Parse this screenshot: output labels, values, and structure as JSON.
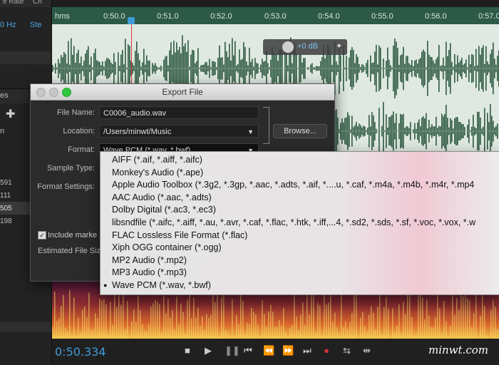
{
  "left_panel": {
    "header_fragments": [
      "e Rate",
      "Ch"
    ],
    "row_1": {
      "left": "0 Hz",
      "right": "Ste"
    },
    "tab_fragment": "es",
    "row_letter": "n",
    "numbers": [
      "591",
      "111",
      "505",
      "198"
    ]
  },
  "timeline": {
    "ruler_label": "hms",
    "ticks": [
      "0:50.0",
      "0:51.0",
      "0:52.0",
      "0:53.0",
      "0:54.0",
      "0:55.0",
      "0:56.0",
      "0:57.0"
    ],
    "hud_db": "+0 dB"
  },
  "dialog": {
    "title": "Export File",
    "file_name_label": "File Name:",
    "file_name_value": "C0006_audio.wav",
    "location_label": "Location:",
    "location_value": "/Users/minwt/Music",
    "browse_label": "Browse...",
    "format_label": "Format:",
    "format_value": "Wave PCM (*.wav, *.bwf)",
    "sample_type_label": "Sample Type:",
    "format_settings_label": "Format Settings:",
    "include_markers_label": "Include marke",
    "include_markers_checked": true,
    "estimated_size_label": "Estimated File Siz"
  },
  "format_menu": {
    "selected": "Wave PCM (*.wav, *.bwf)",
    "options": [
      "AIFF (*.aif, *.aiff, *.aifc)",
      "Monkey's Audio (*.ape)",
      "Apple Audio Toolbox (*.3g2, *.3gp, *.aac, *.adts, *.aif, *....u, *.caf, *.m4a, *.m4b, *.m4r, *.mp4",
      "AAC Audio (*.aac, *.adts)",
      "Dolby Digital (*.ac3, *.ec3)",
      "libsndfile (*.aifc, *.aiff, *.au, *.avr, *.caf, *.flac, *.htk, *.iff,...4, *.sd2, *.sds, *.sf, *.voc, *.vox, *.w",
      "FLAC Lossless File Format (*.flac)",
      "Xiph OGG container (*.ogg)",
      "MP2 Audio (*.mp2)",
      "MP3 Audio (*.mp3)",
      "Wave PCM (*.wav, *.bwf)"
    ]
  },
  "transport": {
    "time": "0:50.334"
  },
  "watermark": "minwt.com",
  "colors": {
    "ruler": "#2c5a47",
    "waveform": "#2f5a42",
    "playhead": "#d93a3a",
    "time_display": "#3f9bd6",
    "record": "#d2323f"
  }
}
